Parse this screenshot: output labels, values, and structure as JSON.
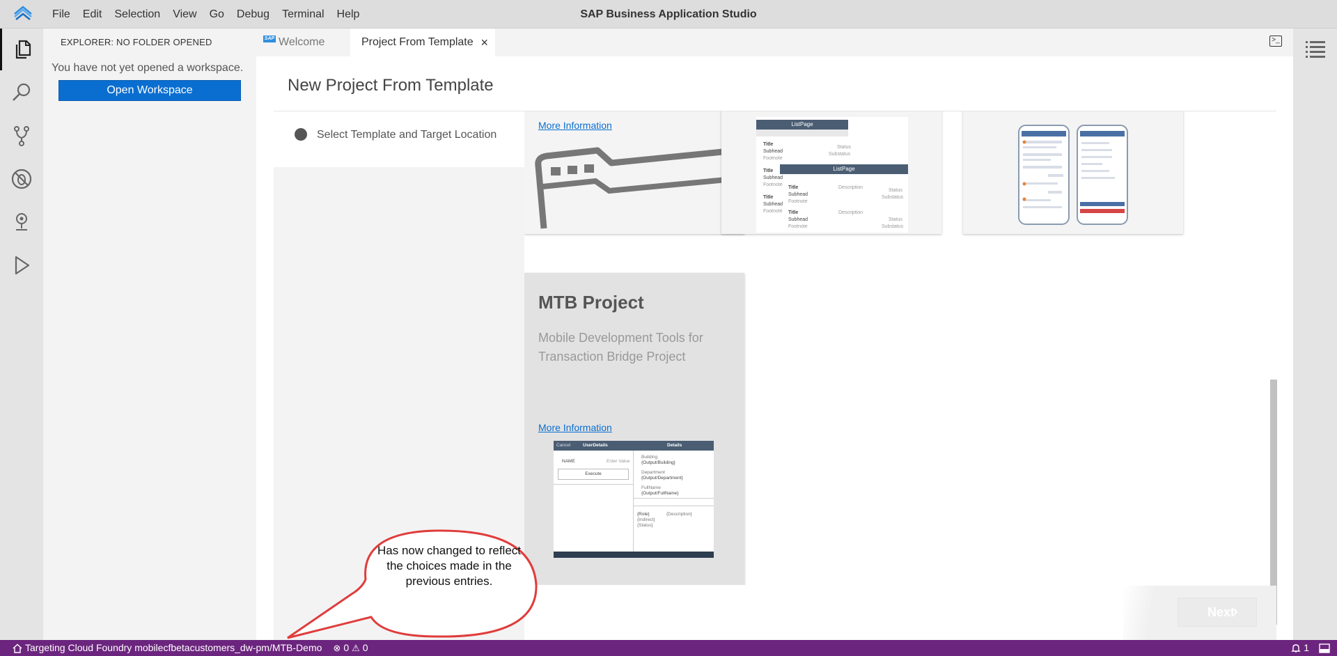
{
  "app": {
    "title": "SAP Business Application Studio"
  },
  "menu": [
    "File",
    "Edit",
    "Selection",
    "View",
    "Go",
    "Debug",
    "Terminal",
    "Help"
  ],
  "sidebar": {
    "title": "EXPLORER: NO FOLDER OPENED",
    "message": "You have not yet opened a workspace.",
    "open_button": "Open Workspace"
  },
  "tabs": [
    {
      "label": "Welcome",
      "icon_text": "SAP"
    },
    {
      "label": "Project From Template",
      "close": "×"
    }
  ],
  "wizard": {
    "title": "New Project From Template",
    "step_label": "Select Template and Target Location",
    "cards": [
      {
        "more_info": "More Information"
      },
      {
        "preview": {
          "header1": "ListPage",
          "header2": "ListPage",
          "row_title": "Title",
          "row_subhead": "Subhead",
          "row_footnote": "Footnote",
          "status": "Status",
          "substatus": "Substatus",
          "description": "Description"
        }
      },
      {
        "preview": "two-phone-mockups"
      },
      {
        "title": "MTB Project",
        "description": "Mobile Development Tools for Transaction Bridge Project",
        "more_info": "More Information",
        "preview": {
          "cancel": "Cancel",
          "user_details": "UserDetails",
          "details": "Details",
          "name": "NAME",
          "enter_value": "Enter Value",
          "execute": "Execute",
          "building": "Building",
          "building_val": "{Output/Building}",
          "department": "Department",
          "department_val": "{Output/Department}",
          "fullname": "FullName",
          "fullname_val": "{Output/FullName}",
          "role": "{Role}",
          "description": "{Description}",
          "indirect": "{Indirect}",
          "status": "{Status}"
        }
      }
    ],
    "next_button": "Next",
    "next_chevron": "›"
  },
  "statusbar": {
    "target": "Targeting Cloud Foundry mobilecfbetacustomers_dw-pm/MTB-Demo",
    "errors": "0",
    "warnings": "0",
    "notifications": "1"
  },
  "callout": {
    "text": "Has now changed to reflect the choices made in the previous entries."
  },
  "colors": {
    "accent": "#0a6ed1",
    "statusbar": "#6c257e",
    "callout_border": "#e03c3c"
  }
}
